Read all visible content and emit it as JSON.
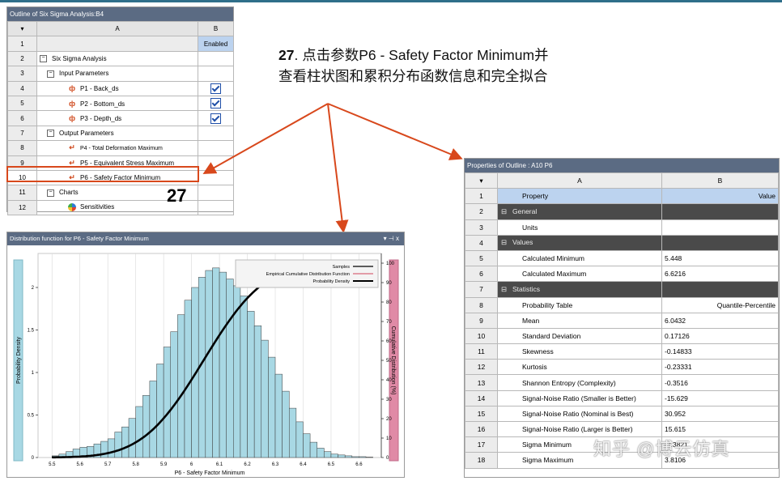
{
  "outline": {
    "title": "Outline of Six Sigma Analysis:B4",
    "col_a": "A",
    "col_b": "B",
    "rows": [
      {
        "num": "1",
        "label": "",
        "b": "Enabled"
      },
      {
        "num": "2",
        "label": "Six Sigma Analysis",
        "b": ""
      },
      {
        "num": "3",
        "label": "Input Parameters",
        "b": ""
      },
      {
        "num": "4",
        "label": "P1 - Back_ds",
        "b": "check"
      },
      {
        "num": "5",
        "label": "P2 - Bottom_ds",
        "b": "check"
      },
      {
        "num": "6",
        "label": "P3 - Depth_ds",
        "b": "check"
      },
      {
        "num": "7",
        "label": "Output Parameters",
        "b": ""
      },
      {
        "num": "8",
        "label": "P4 - Total Deformation Maximum",
        "b": ""
      },
      {
        "num": "9",
        "label": "P5 - Equivalent Stress Maximum",
        "b": ""
      },
      {
        "num": "10",
        "label": "P6 - Safety Factor Minimum",
        "b": ""
      },
      {
        "num": "11",
        "label": "Charts",
        "b": ""
      },
      {
        "num": "12",
        "label": "Sensitivities",
        "b": ""
      }
    ],
    "callout": "27"
  },
  "annotation": {
    "step": "27",
    "line1": ". 点击参数P6 - Safety Factor Minimum并",
    "line2": "查看柱状图和累积分布函数信息和完全拟合"
  },
  "properties": {
    "title": "Properties of Outline : A10 P6",
    "col_a": "A",
    "col_b": "B",
    "rows": [
      {
        "num": "1",
        "a": "Property",
        "b": "Value",
        "kind": "header"
      },
      {
        "num": "2",
        "a": "General",
        "b": "",
        "kind": "section"
      },
      {
        "num": "3",
        "a": "Units",
        "b": "",
        "kind": "item"
      },
      {
        "num": "4",
        "a": "Values",
        "b": "",
        "kind": "section"
      },
      {
        "num": "5",
        "a": "Calculated Minimum",
        "b": "5.448",
        "kind": "item"
      },
      {
        "num": "6",
        "a": "Calculated Maximum",
        "b": "6.6216",
        "kind": "item"
      },
      {
        "num": "7",
        "a": "Statistics",
        "b": "",
        "kind": "section"
      },
      {
        "num": "8",
        "a": "Probability Table",
        "b": "Quantile-Percentile",
        "kind": "item-right"
      },
      {
        "num": "9",
        "a": "Mean",
        "b": "6.0432",
        "kind": "item"
      },
      {
        "num": "10",
        "a": "Standard Deviation",
        "b": "0.17126",
        "kind": "item"
      },
      {
        "num": "11",
        "a": "Skewness",
        "b": "-0.14833",
        "kind": "item"
      },
      {
        "num": "12",
        "a": "Kurtosis",
        "b": "-0.23331",
        "kind": "item"
      },
      {
        "num": "13",
        "a": "Shannon Entropy (Complexity)",
        "b": "-0.3516",
        "kind": "item"
      },
      {
        "num": "14",
        "a": "Signal-Noise Ratio (Smaller is Better)",
        "b": "-15.629",
        "kind": "item"
      },
      {
        "num": "15",
        "a": "Signal-Noise Ratio (Nominal is Best)",
        "b": "30.952",
        "kind": "item"
      },
      {
        "num": "16",
        "a": "Signal-Noise Ratio (Larger is Better)",
        "b": "15.615",
        "kind": "item"
      },
      {
        "num": "17",
        "a": "Sigma Minimum",
        "b": "-3.3821",
        "kind": "item"
      },
      {
        "num": "18",
        "a": "Sigma Maximum",
        "b": "3.8106",
        "kind": "item"
      }
    ]
  },
  "chart_panel": {
    "title": "Distribution function for P6 - Safety Factor Minimum",
    "controls": "▾ ⊣ x"
  },
  "chart_data": {
    "type": "bar",
    "xlabel": "P6 - Safety Factor Minimum",
    "ylabel": "Probability Density",
    "y2label": "Cumulative Distribution (%)",
    "xlim": [
      5.45,
      6.68
    ],
    "ylim": [
      0,
      2.4
    ],
    "y2lim": [
      0,
      105
    ],
    "xticks": [
      5.5,
      5.6,
      5.7,
      5.8,
      5.9,
      6,
      6.1,
      6.2,
      6.3,
      6.4,
      6.5,
      6.6
    ],
    "yticks": [
      0,
      0.5,
      1,
      1.5,
      2
    ],
    "y2ticks": [
      0,
      10,
      20,
      30,
      40,
      50,
      60,
      70,
      80,
      90,
      100
    ],
    "legend": [
      "Samples",
      "Empirical Cumulative Distribution Function",
      "Probability Density"
    ],
    "bins": [
      5.5,
      5.525,
      5.55,
      5.575,
      5.6,
      5.625,
      5.65,
      5.675,
      5.7,
      5.725,
      5.75,
      5.775,
      5.8,
      5.825,
      5.85,
      5.875,
      5.9,
      5.925,
      5.95,
      5.975,
      6.0,
      6.025,
      6.05,
      6.075,
      6.1,
      6.125,
      6.15,
      6.175,
      6.2,
      6.225,
      6.25,
      6.275,
      6.3,
      6.325,
      6.35,
      6.375,
      6.4,
      6.425,
      6.45,
      6.475,
      6.5,
      6.525,
      6.55,
      6.575,
      6.6,
      6.625
    ],
    "bin_width": 0.025,
    "values": [
      0.02,
      0.04,
      0.07,
      0.1,
      0.12,
      0.13,
      0.16,
      0.19,
      0.22,
      0.3,
      0.36,
      0.46,
      0.6,
      0.73,
      0.9,
      1.1,
      1.3,
      1.48,
      1.68,
      1.85,
      2.0,
      2.12,
      2.2,
      2.23,
      2.18,
      2.1,
      2.02,
      1.9,
      1.72,
      1.55,
      1.38,
      1.18,
      0.98,
      0.78,
      0.58,
      0.42,
      0.28,
      0.18,
      0.11,
      0.07,
      0.04,
      0.03,
      0.02,
      0.01,
      0.01,
      0.005
    ],
    "cdf_mean": 6.0432,
    "cdf_sd": 0.17126
  },
  "watermark": "知乎 @博云仿真",
  "colors": {
    "accent_red": "#d8481c",
    "bar_fill": "#a8d8e4",
    "cdf_line": "#000000",
    "left_band": "#a8d8e4",
    "right_band": "#e08aa6",
    "titlebar": "#5b6b83"
  }
}
